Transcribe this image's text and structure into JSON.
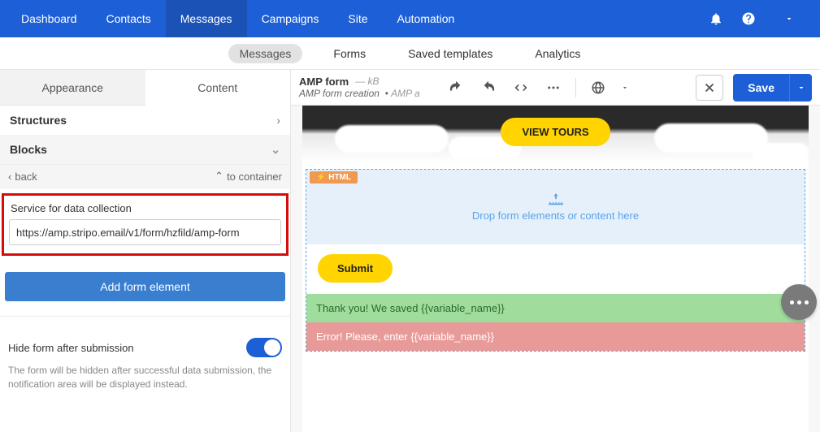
{
  "topnav": {
    "items": [
      "Dashboard",
      "Contacts",
      "Messages",
      "Campaigns",
      "Site",
      "Automation"
    ],
    "active_index": 2
  },
  "subnav": {
    "items": [
      "Messages",
      "Forms",
      "Saved templates",
      "Analytics"
    ],
    "active_index": 0
  },
  "left": {
    "tabs": {
      "appearance": "Appearance",
      "content": "Content",
      "active": "content"
    },
    "sections": {
      "structures": "Structures",
      "blocks": "Blocks"
    },
    "back_row": {
      "back": "back",
      "to_container": "to container"
    },
    "service": {
      "label": "Service for data collection",
      "value": "https://amp.stripo.email/v1/form/hzfild/amp-form"
    },
    "add_btn": "Add form element",
    "toggle": {
      "label": "Hide form after submission",
      "help": "The form will be hidden after successful data submission, the notification area will be displayed instead.",
      "on": true
    }
  },
  "header": {
    "title": "AMP form",
    "size": "— kB",
    "subtitle": "AMP form creation",
    "amp_tag": "AMP a",
    "save": "Save"
  },
  "canvas": {
    "hero_btn": "VIEW TOURS",
    "html_tag": "⚡ HTML",
    "drop_text": "Drop form elements or content here",
    "submit": "Submit",
    "success_msg": "Thank you! We saved {{variable_name}}",
    "error_msg": "Error! Please, enter {{variable_name}}"
  }
}
